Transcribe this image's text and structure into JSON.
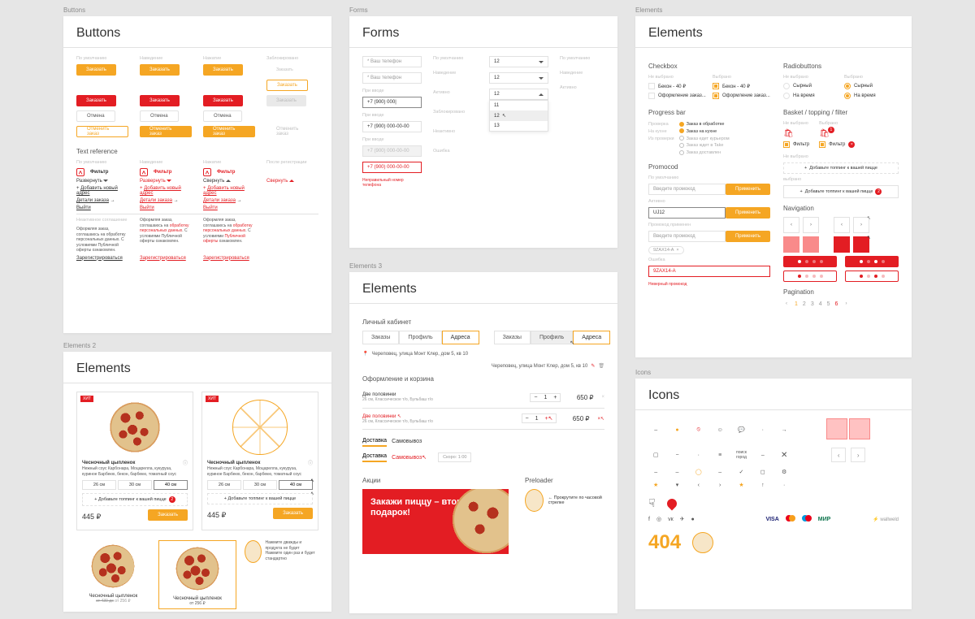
{
  "buttons": {
    "tileLabel": "Buttons",
    "title": "Buttons",
    "states": {
      "default": "По умолчанию",
      "hover": "Наведение",
      "active": "Нажатие",
      "disabled": "Заблокировано"
    },
    "primary": "Заказать",
    "cancel": "Отмена",
    "cancelOrder": "Отменить заказ",
    "textRef": "Text reference",
    "filter": "Фильтр",
    "expand": "Развернуть",
    "collapse": "Свернуть",
    "addAddr": "Добавить новый адрес",
    "orderDetails": "Детали заказа",
    "logout": "Выйти",
    "legal": "Оформляя заказ, соглашаюсь на обработку персональных данных. С условиями Публичной оферты ознакомлен.",
    "legalLink": "обработку персональных данных",
    "register": "Зарегистрироваться",
    "afterReg": "После регистрации"
  },
  "forms": {
    "tileLabel": "Forms",
    "title": "Forms",
    "ph": "* Ваш телефон",
    "filled": "+7 (900) 000",
    "blurred": "+7 (900) 000-00-00",
    "disabled": "+7 (900) 000-00-00",
    "error": "+7 (900) 000-00-00",
    "errorMsg": "Неправильный номер телефона",
    "statesL": {
      "default": "По умолчанию",
      "hover": "Наведение",
      "active": "Активно",
      "disabled": "Заблокировано",
      "blurred": "Неактивно",
      "error": "Ошибка"
    },
    "selectVal": "12",
    "opts": [
      "11",
      "12",
      "13"
    ]
  },
  "elements": {
    "tileLabel": "Elements",
    "title": "Elements",
    "checkbox": {
      "title": "Checkbox",
      "off": "Не выбрано",
      "on": "Выбрано",
      "item1": "Бекон - 40 ₽",
      "item2": "Оформление заказ...",
      "item1on": "Бекон - 40 ₽",
      "item2on": "Оформление заказ..."
    },
    "radio": {
      "title": "Radiobuttons",
      "item1": "Сырный",
      "item2": "На время"
    },
    "progress": {
      "title": "Progress bar",
      "labels": [
        "Проверка",
        "На кухне",
        "Из проверки"
      ],
      "steps": [
        "Заказ в обработке",
        "Заказ на кухне",
        "Заказ едет курьером",
        "Заказ ждет в Take",
        "Заказ доставлен"
      ]
    },
    "promo": {
      "title": "Promocod",
      "ph": "Введите промокод",
      "apply": "Применить",
      "filled": "UJ12",
      "applied": "Промокод применен",
      "chip": "9ZAX14-A",
      "errorVal": "9ZAX14-A",
      "errorMsg": "Неверный промокод"
    },
    "basket": {
      "title": "Basket / topping / filter",
      "off": "Не выбрано",
      "on": "Выбрано",
      "filter": "Фильтр",
      "addTopping": "Добавьте топпинг к вашей пицце",
      "selected": "выбрано"
    },
    "nav": {
      "title": "Navigation"
    },
    "pagination": {
      "title": "Pagination",
      "nums": [
        "1",
        "2",
        "3",
        "4",
        "5",
        "6"
      ]
    }
  },
  "elements2": {
    "tileLabel": "Elements 2",
    "title": "Elements",
    "productName": "Чесночный цыпленок",
    "desc": "Нежный соус Карбонара, Моцарелла, кукуруза, куриное Барбекю, бекон, барбекю, томатный соус",
    "sizes": [
      "26 см",
      "30 см",
      "40 см"
    ],
    "addTopping": "+ Добавьте топпинг к вашей пицце",
    "price": "445 ₽",
    "order": "Заказать",
    "smallPrice": "от 256 ₽",
    "fromPrice": "от 430 до"
  },
  "elements3": {
    "tileLabel": "Elements 3",
    "title": "Elements",
    "lk": "Личный кабинет",
    "tabs": [
      "Заказы",
      "Профиль",
      "Адреса"
    ],
    "address": "Череповец, улица Монт Клер, дом 5, кв 10",
    "basket": "Оформление и корзина",
    "item": "Две половинки",
    "itemDesc": "26 см, Классическое т/о, Бульбаш т/о",
    "qty": "1",
    "price": "650 ₽",
    "delivery": "Доставка",
    "pickup": "Самовывоз",
    "time": "Скоро: 1:00",
    "actions": "Акции",
    "bannerTitle": "Закажи пиццу – вторая в подарок!",
    "preloader": "Preloader",
    "preloaderText": "Прокрутите по часовой стрелке"
  },
  "icons": {
    "tileLabel": "Icons",
    "title": "Icons",
    "made": "wallweld",
    "err": "404",
    "payments": [
      "VISA",
      "mastercard",
      "maestro",
      "МИР"
    ]
  }
}
